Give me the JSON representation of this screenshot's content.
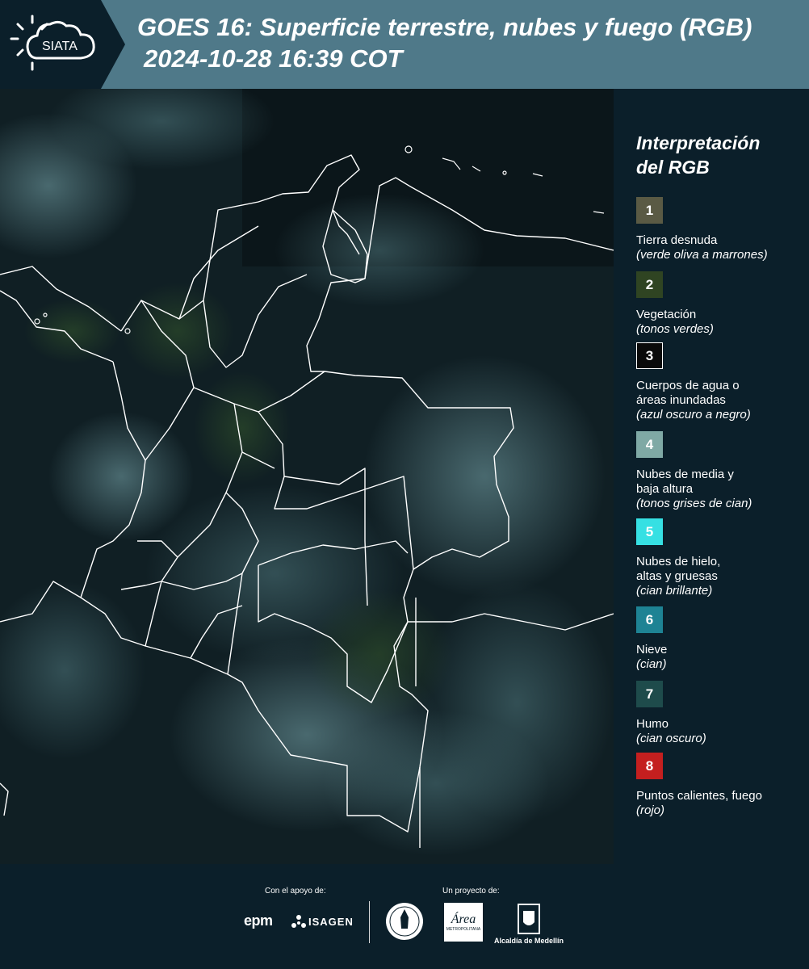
{
  "header": {
    "logo_text": "SIATA",
    "title_line1": "GOES 16: Superficie terrestre, nubes y fuego (RGB)",
    "title_line2": "2024-10-28 16:39 COT"
  },
  "legend": {
    "title_line1": "Interpretación",
    "title_line2": "del RGB",
    "items": [
      {
        "number": "1",
        "color": "#5a5a44",
        "label_lines": [
          "Tierra desnuda"
        ],
        "desc": "(verde oliva a marrones)"
      },
      {
        "number": "2",
        "color": "#2f4422",
        "label_lines": [
          "Vegetación"
        ],
        "desc": "(tonos verdes)"
      },
      {
        "number": "3",
        "color": "#0a0a0a",
        "label_lines": [
          "Cuerpos de agua o",
          "áreas inundadas"
        ],
        "desc": "(azul oscuro a negro)"
      },
      {
        "number": "4",
        "color": "#7fa9a5",
        "label_lines": [
          "Nubes de media y",
          "baja altura"
        ],
        "desc": "(tonos grises de cian)"
      },
      {
        "number": "5",
        "color": "#36e0e3",
        "label_lines": [
          "Nubes de hielo,",
          "altas y gruesas"
        ],
        "desc": "(cian brillante)"
      },
      {
        "number": "6",
        "color": "#1e8394",
        "label_lines": [
          "Nieve"
        ],
        "desc": "(cian)"
      },
      {
        "number": "7",
        "color": "#1e4b4b",
        "label_lines": [
          "Humo"
        ],
        "desc": "(cian oscuro)"
      },
      {
        "number": "8",
        "color": "#c41f1f",
        "label_lines": [
          "Puntos calientes, fuego"
        ],
        "desc": "(rojo)"
      }
    ]
  },
  "footer": {
    "support_label": "Con el apoyo de:",
    "project_label": "Un proyecto de:",
    "sponsor1": "epm",
    "sponsor2": "ISAGEN",
    "partner_area": "Área",
    "partner_area_sub": "METROPOLITANA",
    "partner_alcaldia": "Alcaldía de Medellín"
  }
}
